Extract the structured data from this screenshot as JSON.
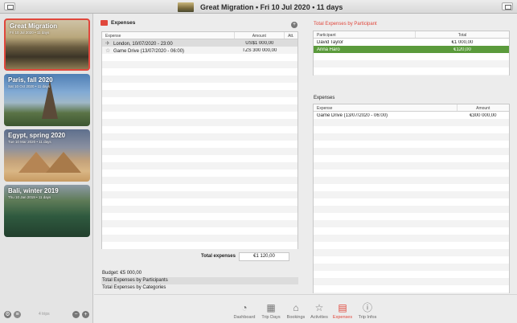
{
  "window": {
    "title": "Great Migration • Fri 10 Jul 2020 •  11 days"
  },
  "sidebar": {
    "trips": [
      {
        "name": "Great Migration",
        "subtitle": "Fri 10 Jul 2020 • 11 days",
        "selected": true
      },
      {
        "name": "Paris, fall 2020",
        "subtitle": "Sat 10 Oct 2020 • 11 days",
        "selected": false
      },
      {
        "name": "Egypt, spring 2020",
        "subtitle": "Tue 10 Mar 2020 • 11 days",
        "selected": false
      },
      {
        "name": "Bali, winter 2019",
        "subtitle": "Thu 10 Jan 2019 • 11 days",
        "selected": false
      }
    ],
    "footer": {
      "trip_count": "4 trips",
      "minus": "−",
      "plus": "+"
    }
  },
  "center": {
    "title": "Expenses",
    "add_label": "+",
    "columns": [
      "Expense",
      "Amount",
      "Att."
    ],
    "rows": [
      {
        "expense": "London, 10/07/2020 - 23:00",
        "amount": "US$1 000,00",
        "att": ""
      },
      {
        "expense": "Game Drive (13/07/2020 - 06:00)",
        "amount": "TZS 300 000,00",
        "att": ""
      }
    ],
    "total_label": "Total expenses",
    "total_value": "€1 120,00",
    "budget_lines": [
      "Budget: €5 000,00",
      "Total Expenses by Participants",
      "Total Expenses by Categories"
    ]
  },
  "right": {
    "participants_title": "Total Expenses by Participant",
    "participants_columns": [
      "Participant",
      "Total"
    ],
    "participants": [
      {
        "name": "David Taylor",
        "total": "€1 000,00"
      },
      {
        "name": "Anna Haro",
        "total": "€120,00"
      }
    ],
    "expenses_title": "Expenses",
    "expenses_columns": [
      "Expense",
      "Amount"
    ],
    "expenses": [
      {
        "expense": "Game Drive (13/07/2020 - 06:00)",
        "amount": "€300 000,00"
      }
    ]
  },
  "toolbar": {
    "items": [
      {
        "label": "Dashboard",
        "icon": "gauge-icon"
      },
      {
        "label": "Trip Days",
        "icon": "calendar-icon"
      },
      {
        "label": "Bookings",
        "icon": "house-icon"
      },
      {
        "label": "Activities",
        "icon": "star-icon"
      },
      {
        "label": "Expenses",
        "icon": "expenses-icon"
      },
      {
        "label": "Trip Infos",
        "icon": "info-icon"
      }
    ],
    "active": "Expenses"
  },
  "colors": {
    "accent": "#e0473c",
    "selection_green": "#5b9b3c"
  }
}
